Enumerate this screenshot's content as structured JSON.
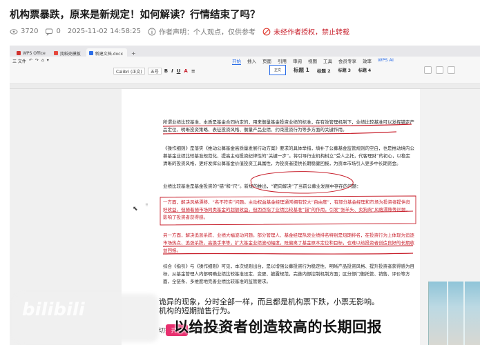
{
  "post": {
    "title": "机构票暴跌，原来是新规定！如何解读？行情结束了吗？",
    "views": "3720",
    "comments": "0",
    "datetime": "2025-11-02 14:58:25",
    "author_statement": "作者声明：个人观点，仅供参考",
    "reprint_notice": "未经作者授权，禁止转载"
  },
  "icons": {
    "views": "eye-icon",
    "comments": "comment-icon",
    "statement": "user-info-icon",
    "reprint": "forbidden-icon"
  },
  "wps": {
    "tabs": [
      "WPS Office",
      "找稻壳模板",
      "新建文档.docx"
    ],
    "tab_colors": [
      "#d0322d",
      "#e5473c",
      "#2b6de8"
    ],
    "menu": [
      "三 文件",
      "↶",
      "↷",
      "⌂",
      "▾"
    ],
    "ribbon_tabs": [
      "开始",
      "插入",
      "页面",
      "引用",
      "审阅",
      "视图",
      "工具",
      "会员专享",
      "效率",
      "WPS AI"
    ],
    "font_name": "Calibri (正文)",
    "font_size": "五号",
    "styles": [
      "正文",
      "标题 1",
      "标题 2",
      "标题 3",
      "标题 4"
    ]
  },
  "document": {
    "p1": "所谓业绩比较基准，本质是基金合同约定的，用来衡量基金投资业绩的标准，在有效管理机制下，业绩比较基准可以发挥锚定产品定位、明晰投资策略、表征投资风格、衡量产品业绩、约束投资行为等多方面的关键作用。",
    "p2": "《操作细则》是落实《推动公募基金高质量发展行动方案》要求的具体举措，填补了公募基金监管规则的空白，也是推动境内公募基金业绩比较基准规范化、提高主动投资纪律性的“关键一步”。将引导行业机构树立“受人之托，代客理财”的初心，以稳定清晰的投资风格，更好发挥公募基金价值投资工具属性，为投资者提供长期稳健回报，为资本市场引入更多中长期资金。",
    "p3": "业绩比较基准是基金投资的“锚”和“尺”。新规的推出，“靶向解决”了当前公募业发展中存在的问题：",
    "p4": "一方面，解决风格漂移、“名不符实”问题。主动权益基金经理通常拥有较大“自由度”，有部分基金经理和市场为投资者提供良好收益，但随着随市场同类基金的超额收益，但因否指了业绩比较基准“锚”的作用，引发“张羊头、卖狗肉”风格漂移等问题，影响了投资者获得感。",
    "p5": "另一方面，解决追涨杀跌、业绩大幅波动问题。部分管理人、基金经理热衷业绩排名特别是短期排名，在投资行为上体现为追逐市场热点、追涨杀跌，高换手率等，扩大基金业绩波动幅度，既偏离了基金原本定位和目标，也难以给投资者创造良好的长期收益回报。",
    "p6": "综合《指引》与《操作细则》可见，本次规则出台，是以增强公募投资行为稳定性、明晰产品投资风格、提升投资者获得感为目标，从基金管理人内部明确业绩比较基准设定、变更、披露规范，完善内部控制机制方面；区分部门衡托管、销售、评价等方面，全链条、多维度地完善业绩比较基准的监管要求。"
  },
  "video": {
    "subtitle_line1": "诡异的现象，分时全部一样，而且都是机构票下跌，小票无影响。",
    "subtitle_line2": "机构的短期抛售行为。",
    "subtitle_line3": "切换到低位的消费？白酒？",
    "caption": "以给投资者创造较高的长期回报",
    "badge": "开通",
    "watermark": "bilibili"
  }
}
